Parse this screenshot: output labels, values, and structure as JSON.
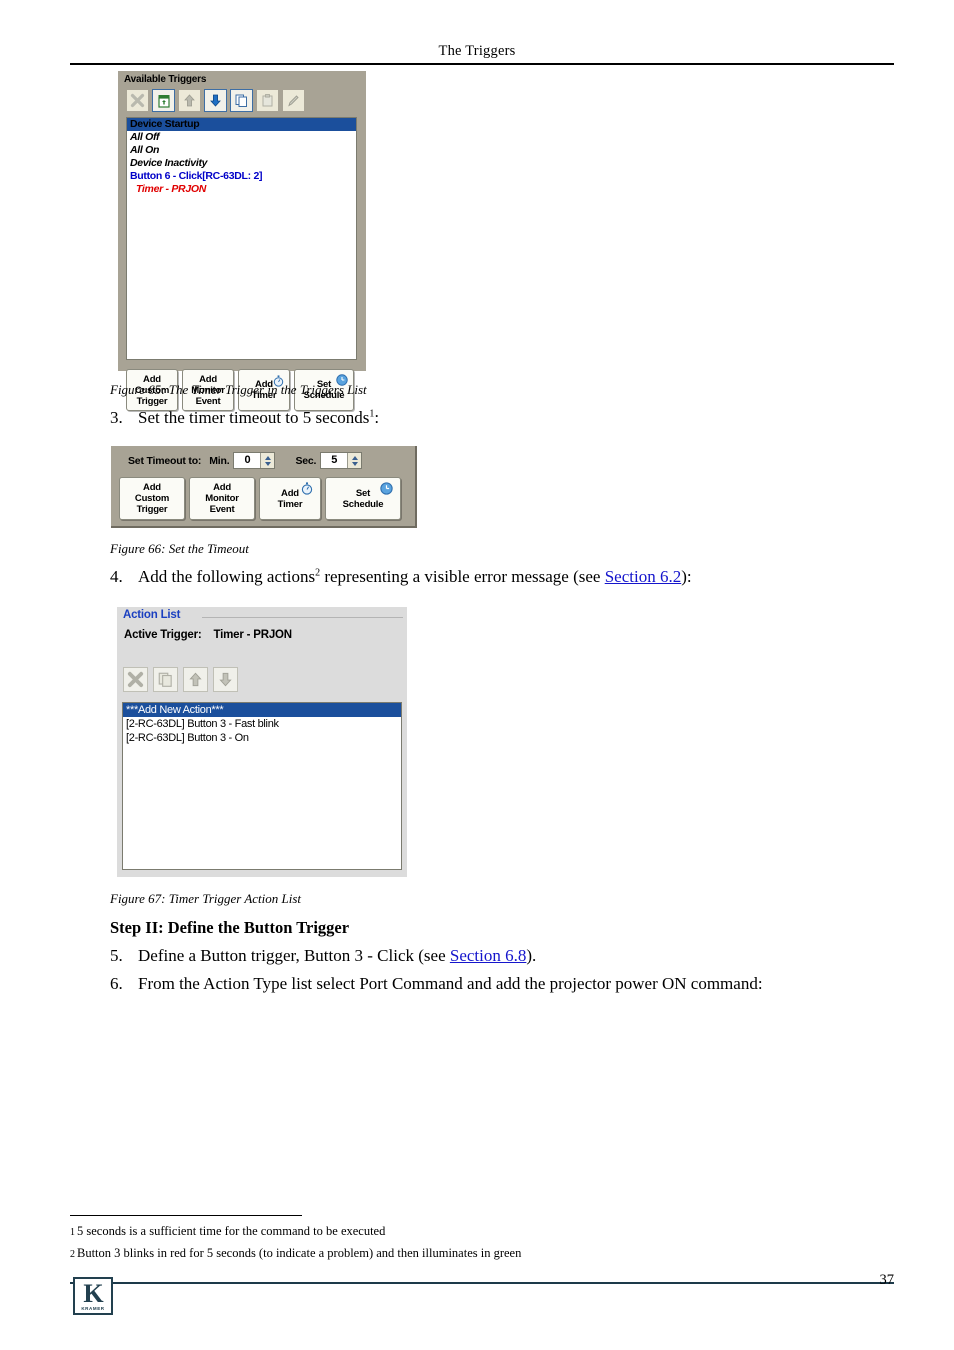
{
  "header": {
    "title": "The Triggers"
  },
  "figure65": {
    "panel_title": "Available Triggers",
    "toolbar": [
      {
        "name": "delete-icon",
        "glyph": "x",
        "state": "disabled"
      },
      {
        "name": "recycle-bin-icon",
        "glyph": "bin",
        "state": "enabled"
      },
      {
        "name": "move-up-icon",
        "glyph": "up",
        "state": "disabled"
      },
      {
        "name": "move-down-icon",
        "glyph": "down",
        "state": "enabled"
      },
      {
        "name": "copy-icon",
        "glyph": "copy",
        "state": "enabled"
      },
      {
        "name": "paste-icon",
        "glyph": "paste",
        "state": "disabled"
      },
      {
        "name": "edit-pencil-icon",
        "glyph": "pencil",
        "state": "disabled"
      }
    ],
    "triggers": [
      {
        "label": "Device Startup",
        "style": "selected"
      },
      {
        "label": "All Off",
        "style": "italic"
      },
      {
        "label": "All On",
        "style": "italic"
      },
      {
        "label": "Device Inactivity",
        "style": "italic"
      },
      {
        "label": "Button 6 - Click[RC-63DL: 2]",
        "style": "blue-bold"
      },
      {
        "label": "Timer - PRJON",
        "style": "red-italic"
      }
    ],
    "buttons": [
      {
        "name": "add-custom-trigger-button",
        "lines": [
          "Add",
          "Custom",
          "Trigger"
        ],
        "icon": "none"
      },
      {
        "name": "add-monitor-event-button",
        "lines": [
          "Add",
          "Monitor",
          "Event"
        ],
        "icon": "none"
      },
      {
        "name": "add-timer-button",
        "lines": [
          "Add",
          "Timer"
        ],
        "icon": "stopwatch-icon"
      },
      {
        "name": "set-schedule-button",
        "lines": [
          "Set",
          "Schedule"
        ],
        "icon": "clock-icon"
      }
    ],
    "caption": "Figure 65: The Timer Trigger in the Triggers List"
  },
  "step3": {
    "number": "3.",
    "text_before": "Set the timer timeout to 5 seconds",
    "footnote_marker": "1",
    "text_after": ":"
  },
  "figure66": {
    "label": "Set Timeout to:",
    "min_label": "Min.",
    "min_value": "0",
    "sec_label": "Sec.",
    "sec_value": "5",
    "buttons": [
      {
        "name": "add-custom-trigger-button",
        "lines": [
          "Add",
          "Custom",
          "Trigger"
        ],
        "icon": "none"
      },
      {
        "name": "add-monitor-event-button",
        "lines": [
          "Add",
          "Monitor",
          "Event"
        ],
        "icon": "none"
      },
      {
        "name": "add-timer-button",
        "lines": [
          "Add",
          "Timer"
        ],
        "icon": "stopwatch-icon"
      },
      {
        "name": "set-schedule-button",
        "lines": [
          "Set",
          "Schedule"
        ],
        "icon": "clock-icon"
      }
    ],
    "caption": "Figure 66: Set the Timeout"
  },
  "step4": {
    "number": "4.",
    "text_before": "Add the following actions",
    "footnote_marker": "2",
    "text_mid": " representing a visible error message (see ",
    "link": "Section 6.2",
    "text_after": "):"
  },
  "figure67": {
    "panel_title": "Action List",
    "active_trigger_label": "Active Trigger:",
    "active_trigger_value": "Timer - PRJON",
    "toolbar": [
      {
        "name": "delete-icon",
        "glyph": "x",
        "state": "disabled"
      },
      {
        "name": "copy-icon",
        "glyph": "copy",
        "state": "disabled"
      },
      {
        "name": "move-up-icon",
        "glyph": "up",
        "state": "disabled"
      },
      {
        "name": "move-down-icon",
        "glyph": "down",
        "state": "disabled"
      }
    ],
    "actions": [
      {
        "label": "***Add New Action***",
        "style": "selected"
      },
      {
        "label": "[2-RC-63DL] Button 3 - Fast blink",
        "style": "normal"
      },
      {
        "label": "[2-RC-63DL] Button 3 - On",
        "style": "normal"
      }
    ],
    "caption": "Figure 67: Timer Trigger Action List"
  },
  "step_heading": "Step II: Define the Button Trigger",
  "step5": {
    "number": "5.",
    "text_before": "Define a Button trigger, Button 3 - Click (see ",
    "link": "Section 6.8",
    "text_after": ")."
  },
  "step6": {
    "number": "6.",
    "text": "From the Action Type list select Port Command and add the projector power ON command:"
  },
  "footnotes": [
    {
      "num": "1",
      "text": "5 seconds is a sufficient time for the command to be executed"
    },
    {
      "num": "2",
      "text": "Button 3 blinks in red for 5 seconds (to indicate a problem) and then illuminates in green"
    }
  ],
  "footer": {
    "logo_glyph": "K",
    "logo_word": "KRAMER",
    "page_number": "37"
  },
  "colors": {
    "panel_taupe": "#a8a395",
    "panel_gray": "#dcdcdc",
    "selection_blue": "#1b4f9c",
    "link_blue": "#1515cc",
    "trigger_blue": "#0000c8",
    "trigger_red": "#e00000",
    "action_list_title": "#1a3fc0",
    "kramer_navy": "#22404f"
  }
}
